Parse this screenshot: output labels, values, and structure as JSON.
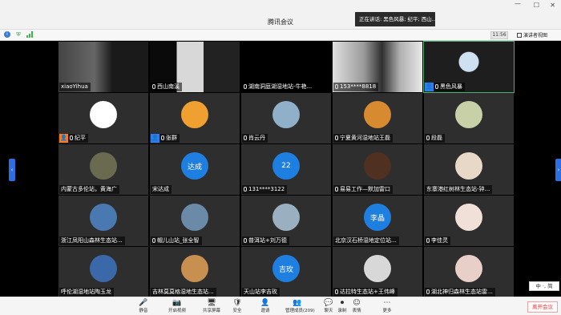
{
  "window": {
    "title": "腾讯会议",
    "speaking_label": "正在讲话: 黑色风暴; 纪平; 西山...",
    "controls": [
      "—",
      "☐",
      "✕"
    ]
  },
  "topbar": {
    "timer": "11:56",
    "speaker_view_label": "演讲者视图"
  },
  "tiles": [
    {
      "name": "xiaoYihua",
      "mic": false,
      "role": "",
      "type": "video",
      "bg": "#1a1a1a"
    },
    {
      "name": "西山南溪",
      "mic": true,
      "role": "",
      "type": "video",
      "bg": "#0a0a0a"
    },
    {
      "name": "湖南洞庭湖湿地站-牛艳...",
      "mic": true,
      "role": "",
      "type": "video",
      "bg": "#000000"
    },
    {
      "name": "153****8818",
      "mic": true,
      "role": "",
      "type": "video",
      "bg": "#555555"
    },
    {
      "name": "黑色风暴",
      "mic": true,
      "role": "blue",
      "type": "video",
      "bg": "#1e1e1e"
    },
    {
      "name": "纪平",
      "mic": true,
      "role": "orange",
      "type": "avatar",
      "avatar_color": "#ffffff"
    },
    {
      "name": "张群",
      "mic": true,
      "role": "blue",
      "type": "avatar",
      "avatar_color": "#f0a030"
    },
    {
      "name": "肖云丹",
      "mic": true,
      "role": "",
      "type": "avatar",
      "avatar_color": "#8fb0c8"
    },
    {
      "name": "宁夏黄河湿地站王磊",
      "mic": true,
      "role": "",
      "type": "avatar",
      "avatar_color": "#d88a30"
    },
    {
      "name": "段磊",
      "mic": true,
      "role": "",
      "type": "avatar",
      "avatar_color": "#c8d0a8"
    },
    {
      "name": "内蒙古多伦站，黄海广",
      "mic": false,
      "role": "",
      "type": "avatar",
      "avatar_color": "#6a6a50"
    },
    {
      "name": "宋达成",
      "mic": false,
      "role": "",
      "type": "initials",
      "initials": "达成"
    },
    {
      "name": "131****3122",
      "mic": true,
      "role": "",
      "type": "initials",
      "initials": "22"
    },
    {
      "name": "易易工作—默加雷口",
      "mic": true,
      "role": "",
      "type": "avatar",
      "avatar_color": "#503020"
    },
    {
      "name": "东寨港红树林生态站-钟...",
      "mic": false,
      "role": "",
      "type": "avatar",
      "avatar_color": "#e8d8c8"
    },
    {
      "name": "浙江凤阳山森林生态站...",
      "mic": false,
      "role": "",
      "type": "avatar",
      "avatar_color": "#4a78b0"
    },
    {
      "name": "帽儿山站_张全智",
      "mic": true,
      "role": "",
      "type": "avatar",
      "avatar_color": "#6a8aa8"
    },
    {
      "name": "普洱站+刘万德",
      "mic": true,
      "role": "",
      "type": "avatar",
      "avatar_color": "#9ab0c0"
    },
    {
      "name": "北京汉石桥湿地定位站...",
      "mic": false,
      "role": "",
      "type": "initials",
      "initials": "李晶"
    },
    {
      "name": "李佳灵",
      "mic": true,
      "role": "",
      "type": "avatar",
      "avatar_color": "#f0e0d8"
    },
    {
      "name": "呼伦湖湿地站陶玉龙",
      "mic": false,
      "role": "",
      "type": "avatar",
      "avatar_color": "#3a68a8"
    },
    {
      "name": "吉林莫莫格湿地生态站...",
      "mic": false,
      "role": "",
      "type": "avatar",
      "avatar_color": "#c89050"
    },
    {
      "name": "天山站李吉玫",
      "mic": false,
      "role": "",
      "type": "initials",
      "initials": "吉玫"
    },
    {
      "name": "达拉特生态站+王伟峰",
      "mic": true,
      "role": "",
      "type": "avatar",
      "avatar_color": "#d8d8d8"
    },
    {
      "name": "湖北神归森林生态站雷...",
      "mic": true,
      "role": "",
      "type": "avatar",
      "avatar_color": "#e8d0c8"
    }
  ],
  "bottombar": {
    "items": [
      {
        "label": "静音",
        "icon": "🎤"
      },
      {
        "label": "开启视频",
        "icon": "📷"
      },
      {
        "label": "共享屏幕",
        "icon": "🖥"
      },
      {
        "label": "安全",
        "icon": "🛡"
      },
      {
        "label": "邀请",
        "icon": "👤"
      },
      {
        "label": "管理成员(209)",
        "icon": "👥"
      },
      {
        "label": "聊天",
        "icon": "💬"
      },
      {
        "label": "录制",
        "icon": "⏺"
      },
      {
        "label": "表情",
        "icon": "☺"
      },
      {
        "label": "更多",
        "icon": "⋯"
      }
    ],
    "leave_label": "离开会议"
  },
  "ime": "中 ·, 简"
}
